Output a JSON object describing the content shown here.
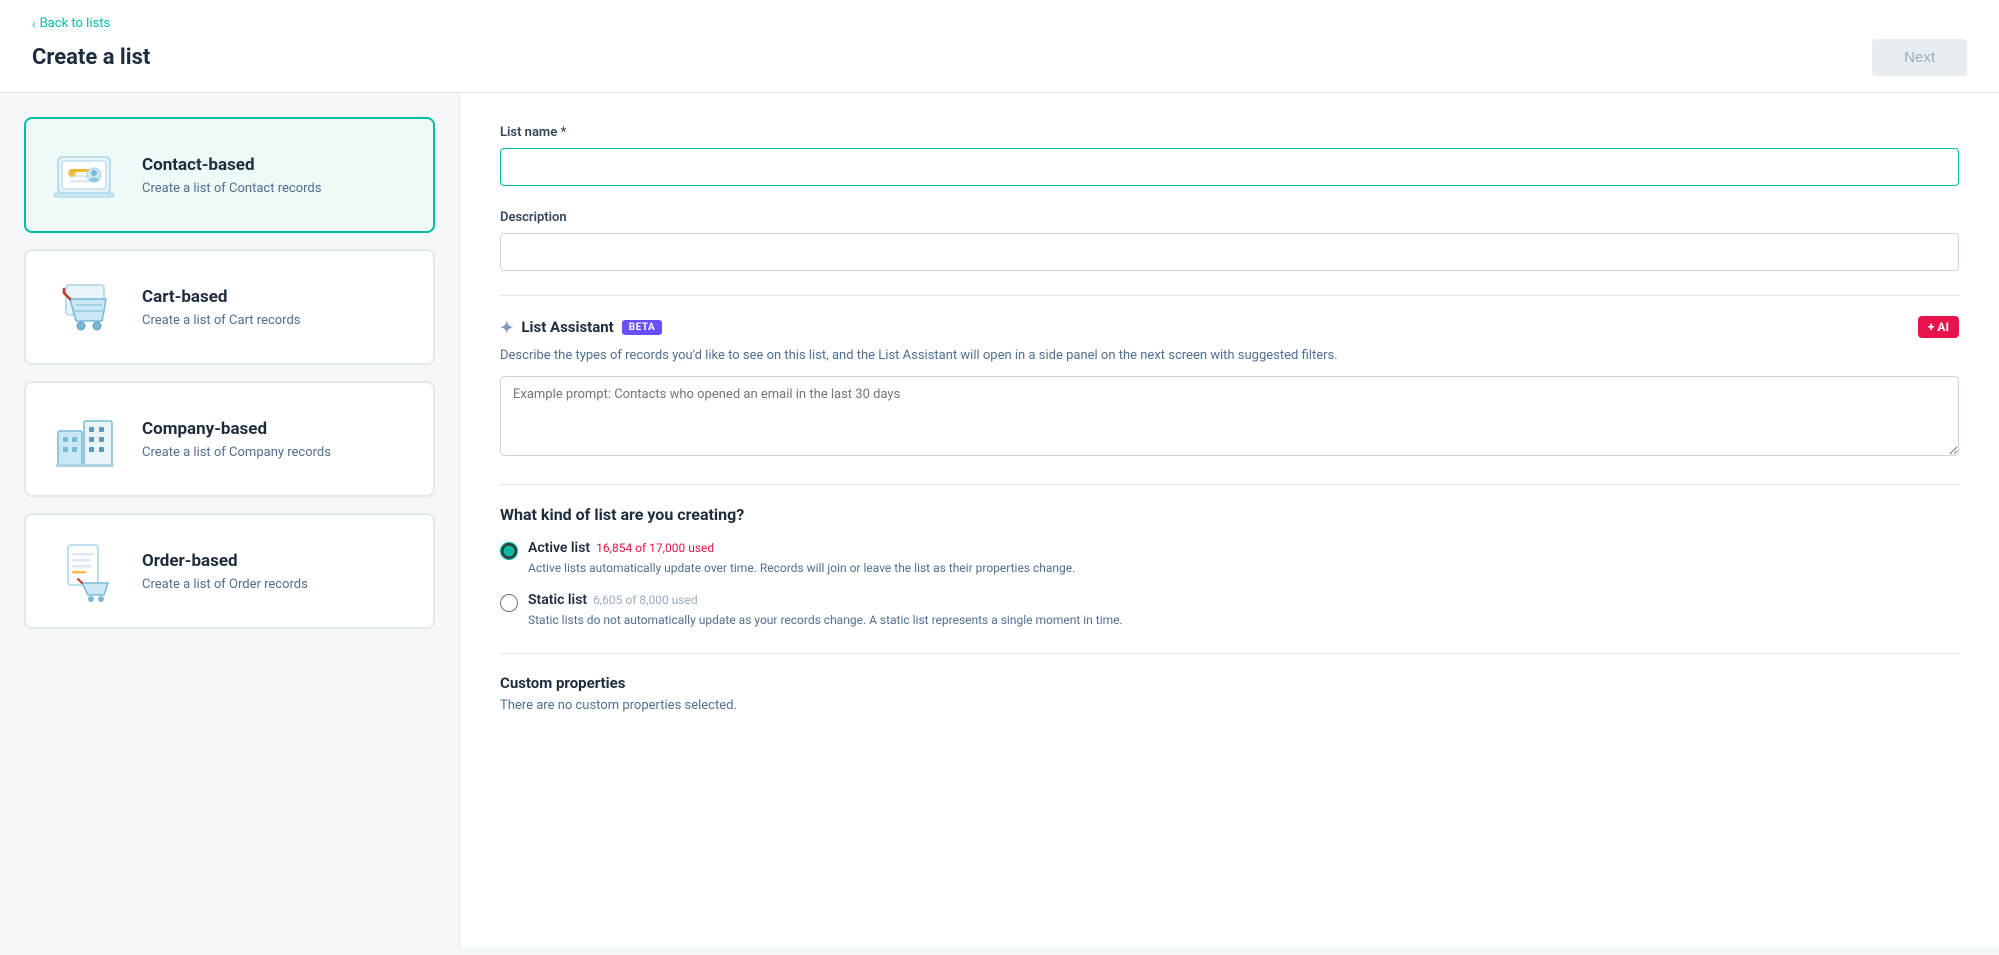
{
  "header": {
    "back_label": "Back to lists",
    "title": "Create a list",
    "next_button": "Next"
  },
  "list_types": [
    {
      "id": "contact",
      "title": "Contact-based",
      "description": "Create a list of Contact records",
      "selected": true
    },
    {
      "id": "cart",
      "title": "Cart-based",
      "description": "Create a list of Cart records",
      "selected": false
    },
    {
      "id": "company",
      "title": "Company-based",
      "description": "Create a list of Company records",
      "selected": false
    },
    {
      "id": "order",
      "title": "Order-based",
      "description": "Create a list of Order records",
      "selected": false
    }
  ],
  "form": {
    "list_name_label": "List name *",
    "list_name_placeholder": "",
    "description_label": "Description",
    "description_placeholder": "",
    "assistant": {
      "title": "List Assistant",
      "beta_badge": "BETA",
      "ai_badge": "+ AI",
      "description": "Describe the types of records you'd like to see on this list, and the List Assistant will open in a side panel on the next screen with suggested filters.",
      "placeholder": "Example prompt: Contacts who opened an email in the last 30 days"
    },
    "list_kind_title": "What kind of list are you creating?",
    "list_options": [
      {
        "id": "active",
        "label": "Active list",
        "usage": "16,854 of 17,000 used",
        "description": "Active lists automatically update over time. Records will join or leave the list as their properties change.",
        "selected": true
      },
      {
        "id": "static",
        "label": "Static list",
        "usage": "6,605 of 8,000 used",
        "description": "Static lists do not automatically update as your records change. A static list represents a single moment in time.",
        "selected": false
      }
    ],
    "custom_props_title": "Custom properties",
    "custom_props_desc": "There are no custom properties selected."
  }
}
